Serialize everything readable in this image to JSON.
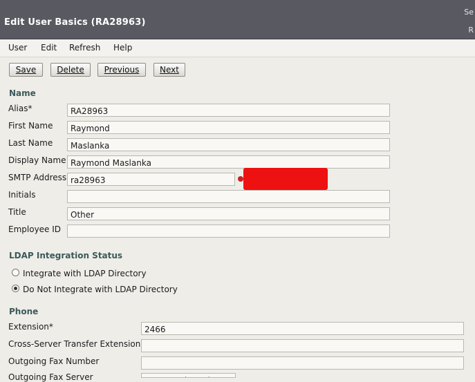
{
  "window": {
    "title": "Edit User Basics  (RA28963)",
    "right_text_1": "Se",
    "right_text_2": "R"
  },
  "menu": [
    "User",
    "Edit",
    "Refresh",
    "Help"
  ],
  "toolbar": {
    "save": "Save",
    "delete": "Delete",
    "previous": "Previous",
    "next": "Next"
  },
  "name_section": {
    "heading": "Name",
    "alias_label": "Alias*",
    "alias_value": "RA28963",
    "first_name_label": "First Name",
    "first_name_value": "Raymond",
    "last_name_label": "Last Name",
    "last_name_value": "Maslanka",
    "display_name_label": "Display Name",
    "display_name_value": "Raymond Maslanka",
    "smtp_label": "SMTP Address",
    "smtp_value": "ra28963",
    "initials_label": "Initials",
    "initials_value": "",
    "title_label": "Title",
    "title_value": "Other",
    "employee_id_label": "Employee ID",
    "employee_id_value": ""
  },
  "ldap_section": {
    "heading": "LDAP Integration Status",
    "option_integrate": "Integrate with LDAP Directory",
    "option_do_not_integrate": "Do Not Integrate with LDAP Directory",
    "selected": "Do Not Integrate with LDAP Directory"
  },
  "phone_section": {
    "heading": "Phone",
    "extension_label": "Extension*",
    "extension_value": "2466",
    "cross_server_label": "Cross-Server Transfer Extension",
    "cross_server_value": "",
    "fax_number_label": "Outgoing Fax Number",
    "fax_number_value": "",
    "fax_server_label": "Outgoing Fax Server",
    "fax_server_value": "Not Selected"
  },
  "colors": {
    "titlebar": "#595962",
    "section_heading": "#3a5a5a",
    "redaction": "#ee1111"
  }
}
